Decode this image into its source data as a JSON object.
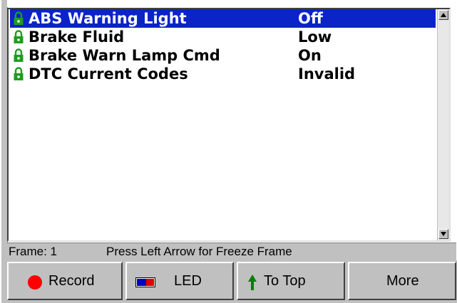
{
  "list": {
    "rows": [
      {
        "name": "ABS Warning Light",
        "value": "Off",
        "selected": true
      },
      {
        "name": "Brake Fluid",
        "value": "Low",
        "selected": false
      },
      {
        "name": "Brake Warn Lamp Cmd",
        "value": "On",
        "selected": false
      },
      {
        "name": "DTC Current Codes",
        "value": "Invalid",
        "selected": false
      }
    ],
    "lock_icon": "green-padlock-icon",
    "selection_color": "#0a24c8",
    "lock_color": "#1e9e1e"
  },
  "status": {
    "frame_label": "Frame: 1",
    "hint": "Press Left Arrow for Freeze Frame"
  },
  "buttons": {
    "record": {
      "label": "Record",
      "icon": "red-circle-icon",
      "icon_color": "#ff0000"
    },
    "led": {
      "label": "LED",
      "icon": "led-indicator-icon"
    },
    "to_top": {
      "label": "To Top",
      "icon": "green-up-arrow-icon",
      "icon_color": "#008000"
    },
    "more": {
      "label": "More"
    }
  }
}
